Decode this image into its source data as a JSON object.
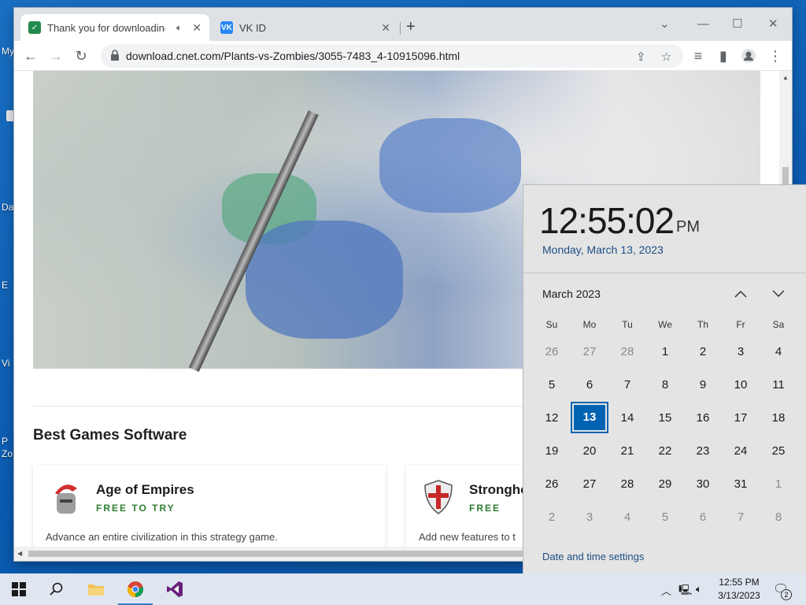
{
  "desktop": {
    "labels": [
      "My",
      "Da",
      "E",
      "Vi",
      "P",
      "Zo"
    ]
  },
  "browser": {
    "tabs": [
      {
        "title": "Thank you for downloading",
        "favicon": "cnet-favicon"
      },
      {
        "title": "VK ID",
        "favicon": "vk-favicon"
      }
    ],
    "url": "download.cnet.com/Plants-vs-Zombies/3055-7483_4-10915096.html"
  },
  "page": {
    "section_title": "Best Games Software",
    "cards": [
      {
        "name": "Age of Empires",
        "price": "FREE TO TRY",
        "description": "Advance an entire civilization in this strategy game."
      },
      {
        "name": "Strongho",
        "price": "FREE",
        "description": "Add new features to t"
      }
    ]
  },
  "clock": {
    "time": "12:55:02",
    "ampm": "PM",
    "date": "Monday, March 13, 2023",
    "month": "March 2023",
    "weekdays": [
      "Su",
      "Mo",
      "Tu",
      "We",
      "Th",
      "Fr",
      "Sa"
    ],
    "weeks": [
      [
        "26",
        "27",
        "28",
        "1",
        "2",
        "3",
        "4"
      ],
      [
        "5",
        "6",
        "7",
        "8",
        "9",
        "10",
        "11"
      ],
      [
        "12",
        "13",
        "14",
        "15",
        "16",
        "17",
        "18"
      ],
      [
        "19",
        "20",
        "21",
        "22",
        "23",
        "24",
        "25"
      ],
      [
        "26",
        "27",
        "28",
        "29",
        "30",
        "31",
        "1"
      ],
      [
        "2",
        "3",
        "4",
        "5",
        "6",
        "7",
        "8"
      ]
    ],
    "today": "13",
    "settings_link": "Date and time settings"
  },
  "taskbar": {
    "time": "12:55 PM",
    "date": "3/13/2023",
    "notifications": "2"
  },
  "colors": {
    "accent": "#0063b1",
    "link": "#1f4e85",
    "price_green": "#2e7d32"
  }
}
